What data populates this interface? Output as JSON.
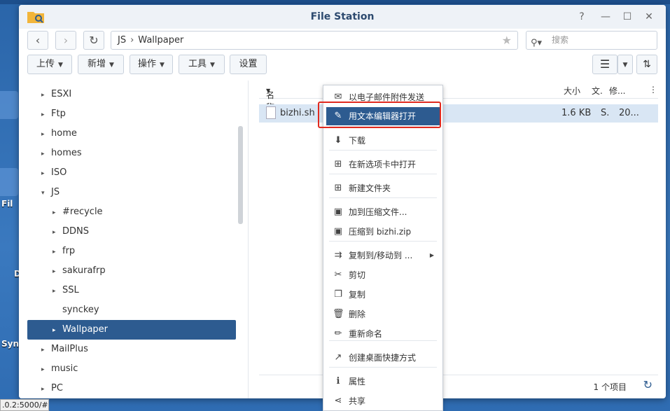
{
  "desktop": {
    "labels": [
      "Fil",
      "D",
      "Syn"
    ]
  },
  "window": {
    "title": "File Station",
    "controls": [
      "?",
      "—",
      "☐",
      "✕"
    ]
  },
  "nav": {
    "back": "‹",
    "forward": "›",
    "refresh": "↻",
    "path": [
      "JS",
      "Wallpaper"
    ],
    "path_sep": "›",
    "search_placeholder": "搜索"
  },
  "toolbar": {
    "upload": "上传",
    "new": "新增",
    "action": "操作",
    "tools": "工具",
    "settings": "设置"
  },
  "tree": {
    "items": [
      {
        "label": "ESXI",
        "indent": 0,
        "arrow": "▸"
      },
      {
        "label": "Ftp",
        "indent": 0,
        "arrow": "▸"
      },
      {
        "label": "home",
        "indent": 0,
        "arrow": "▸"
      },
      {
        "label": "homes",
        "indent": 0,
        "arrow": "▸"
      },
      {
        "label": "ISO",
        "indent": 0,
        "arrow": "▸"
      },
      {
        "label": "JS",
        "indent": 0,
        "arrow": "▾"
      },
      {
        "label": "#recycle",
        "indent": 1,
        "arrow": "▸"
      },
      {
        "label": "DDNS",
        "indent": 1,
        "arrow": "▸"
      },
      {
        "label": "frp",
        "indent": 1,
        "arrow": "▸"
      },
      {
        "label": "sakurafrp",
        "indent": 1,
        "arrow": "▸"
      },
      {
        "label": "SSL",
        "indent": 1,
        "arrow": "▸"
      },
      {
        "label": "synckey",
        "indent": 1,
        "arrow": ""
      },
      {
        "label": "Wallpaper",
        "indent": 1,
        "arrow": "▸",
        "selected": true
      },
      {
        "label": "MailPlus",
        "indent": 0,
        "arrow": "▸"
      },
      {
        "label": "music",
        "indent": 0,
        "arrow": "▸"
      },
      {
        "label": "PC",
        "indent": 0,
        "arrow": "▸"
      }
    ]
  },
  "list": {
    "headers": {
      "name": "名称",
      "size": "大小",
      "type": "文.",
      "modified": "修..."
    },
    "rows": [
      {
        "name": "bizhi.sh",
        "size": "1.6 KB",
        "type": "S.",
        "modified": "20..."
      }
    ],
    "footer_count": "1 个项目"
  },
  "context_menu": {
    "items": [
      {
        "label": "以电子邮件附件发送",
        "icon": "mail-icon",
        "glyph": "✉"
      },
      {
        "label": "用文本编辑器打开",
        "icon": "text-editor-icon",
        "glyph": "✎",
        "highlight": true
      },
      {
        "label": "下载",
        "icon": "download-icon",
        "glyph": "⬇"
      },
      {
        "label": "在新选项卡中打开",
        "icon": "new-tab-icon",
        "glyph": "⊞"
      },
      {
        "label": "新建文件夹",
        "icon": "new-folder-icon",
        "glyph": "⊞"
      },
      {
        "label": "加到压缩文件...",
        "icon": "add-archive-icon",
        "glyph": "▣"
      },
      {
        "label": "压缩到 bizhi.zip",
        "icon": "compress-icon",
        "glyph": "▣"
      },
      {
        "label": "复制到/移动到 ...",
        "icon": "copy-move-icon",
        "glyph": "⇉",
        "submenu": true
      },
      {
        "label": "剪切",
        "icon": "cut-icon",
        "glyph": "✂"
      },
      {
        "label": "复制",
        "icon": "copy-icon",
        "glyph": "❐"
      },
      {
        "label": "删除",
        "icon": "delete-icon",
        "glyph": "🗑"
      },
      {
        "label": "重新命名",
        "icon": "rename-icon",
        "glyph": "✏"
      },
      {
        "label": "创建桌面快捷方式",
        "icon": "shortcut-icon",
        "glyph": "↗"
      },
      {
        "label": "属性",
        "icon": "info-icon",
        "glyph": "ℹ"
      },
      {
        "label": "共享",
        "icon": "share-icon",
        "glyph": "⋖"
      }
    ]
  },
  "statusbar": {
    "url": ".0.2:5000/#"
  },
  "colors": {
    "accent": "#2d5b90",
    "highlight_border": "#e12a1f"
  }
}
